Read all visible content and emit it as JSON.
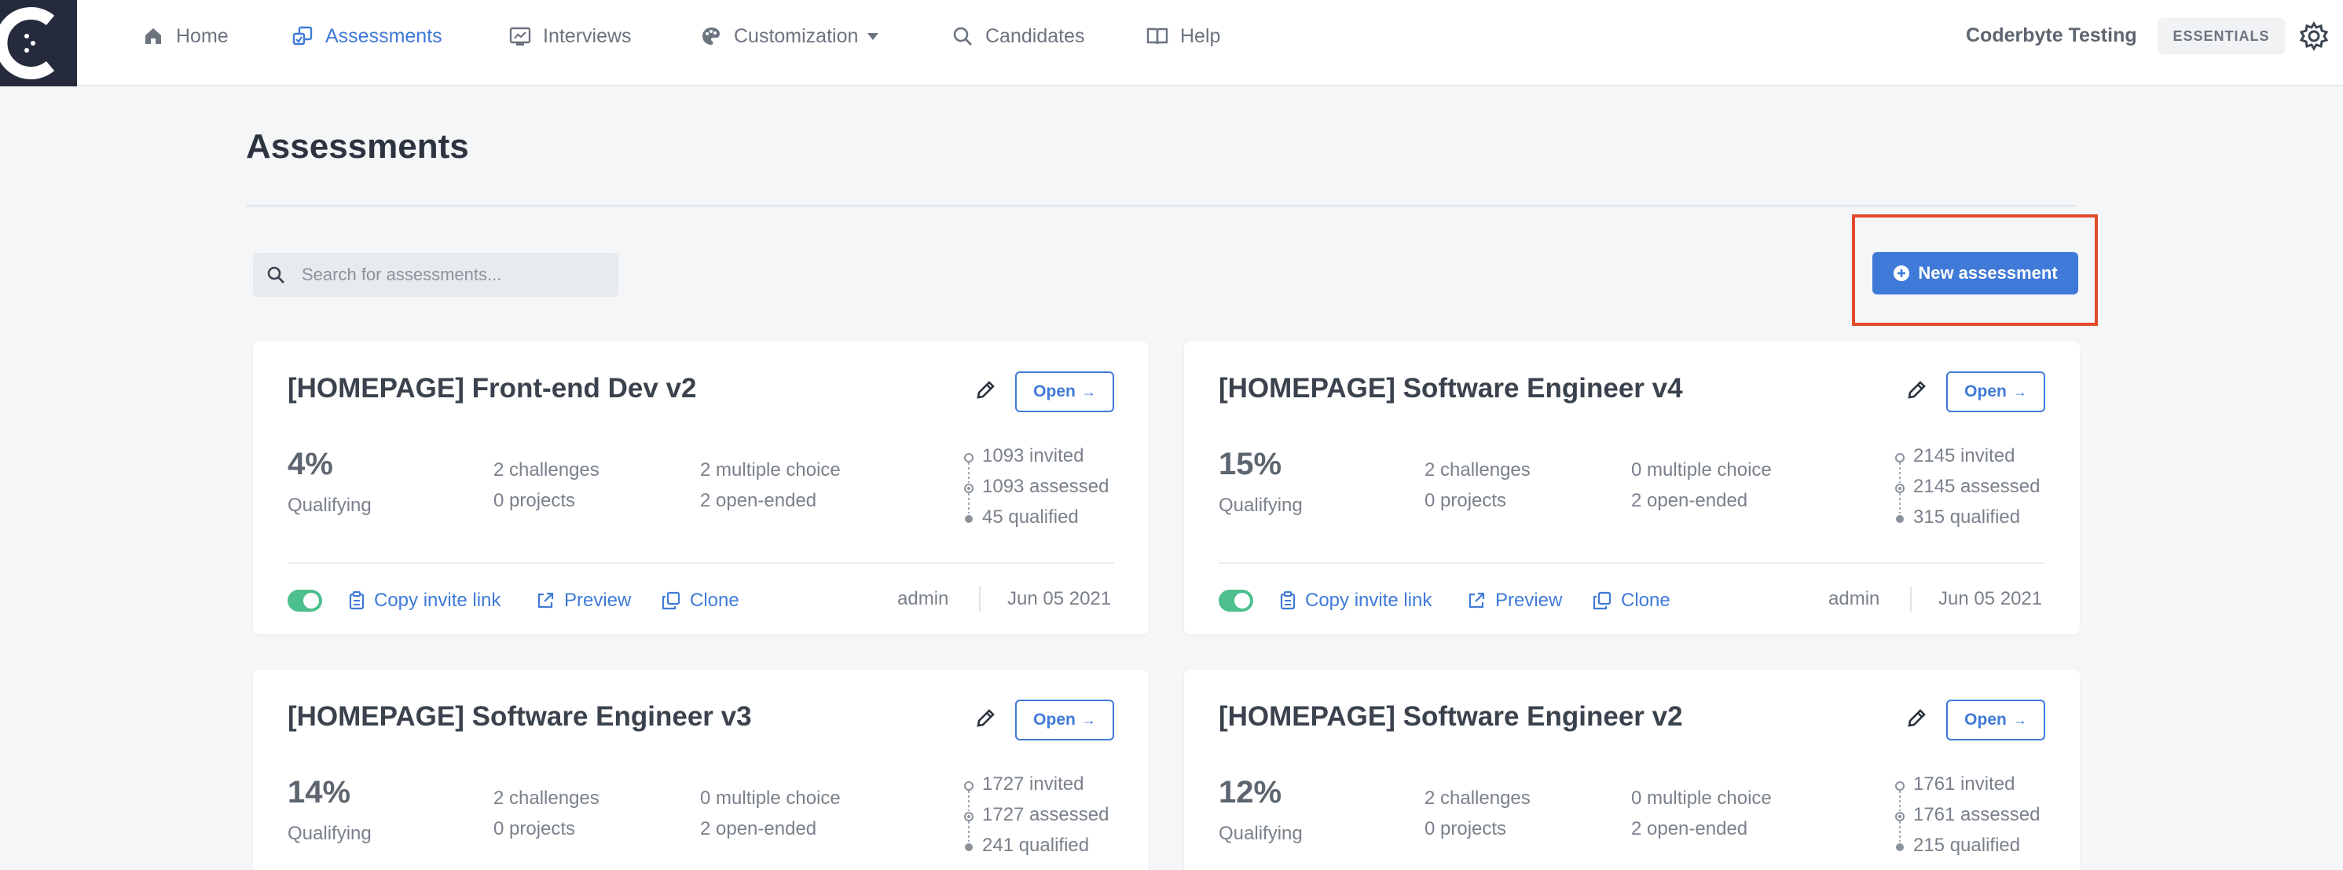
{
  "nav": {
    "items": [
      {
        "label": "Home",
        "icon": "home-icon"
      },
      {
        "label": "Assessments",
        "icon": "assessments-icon",
        "active": true
      },
      {
        "label": "Interviews",
        "icon": "interviews-icon"
      },
      {
        "label": "Customization",
        "icon": "palette-icon",
        "has_dropdown": true
      },
      {
        "label": "Candidates",
        "icon": "search-icon"
      },
      {
        "label": "Help",
        "icon": "book-icon"
      }
    ],
    "org_name": "Coderbyte Testing",
    "plan": "ESSENTIALS"
  },
  "page": {
    "title": "Assessments",
    "search_placeholder": "Search for assessments...",
    "new_button_label": "New assessment"
  },
  "colors": {
    "accent": "#3f7ad8",
    "toggle_on": "#4dbf8e",
    "highlight": "#e24a2b"
  },
  "labels": {
    "open": "Open",
    "qualifying": "Qualifying",
    "copy_invite_link": "Copy invite link",
    "preview": "Preview",
    "clone": "Clone"
  },
  "cards": [
    {
      "title": "[HOMEPAGE] Front-end Dev v2",
      "qualifying_pct": "4%",
      "challenges": "2 challenges",
      "projects": "0 projects",
      "multiple_choice": "2 multiple choice",
      "open_ended": "2 open-ended",
      "invited": "1093 invited",
      "assessed": "1093 assessed",
      "qualified": "45 qualified",
      "active": true,
      "author": "admin",
      "date": "Jun 05 2021"
    },
    {
      "title": "[HOMEPAGE] Software Engineer v4",
      "qualifying_pct": "15%",
      "challenges": "2 challenges",
      "projects": "0 projects",
      "multiple_choice": "0 multiple choice",
      "open_ended": "2 open-ended",
      "invited": "2145 invited",
      "assessed": "2145 assessed",
      "qualified": "315 qualified",
      "active": true,
      "author": "admin",
      "date": "Jun 05 2021"
    },
    {
      "title": "[HOMEPAGE] Software Engineer v3",
      "qualifying_pct": "14%",
      "challenges": "2 challenges",
      "projects": "0 projects",
      "multiple_choice": "0 multiple choice",
      "open_ended": "2 open-ended",
      "invited": "1727 invited",
      "assessed": "1727 assessed",
      "qualified": "241 qualified"
    },
    {
      "title": "[HOMEPAGE] Software Engineer v2",
      "qualifying_pct": "12%",
      "challenges": "2 challenges",
      "projects": "0 projects",
      "multiple_choice": "0 multiple choice",
      "open_ended": "2 open-ended",
      "invited": "1761 invited",
      "assessed": "1761 assessed",
      "qualified": "215 qualified"
    }
  ]
}
